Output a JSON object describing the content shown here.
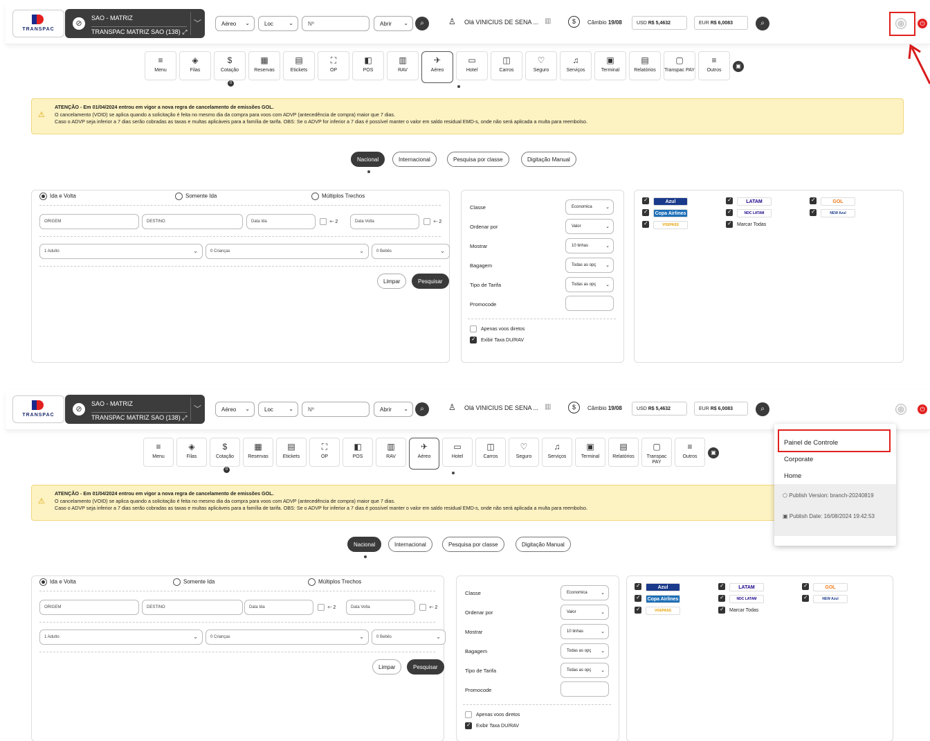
{
  "header": {
    "logo_text": "TRANSPAC",
    "agency_line1": "SAO - MATRIZ",
    "agency_line2": "TRANSPAC MATRIZ SAO (138)",
    "product_select": "Aéreo",
    "loc_select": "Loc",
    "number_placeholder": "Nº",
    "open_select": "Abrir",
    "greeting": "Olá VINICIUS DE SENA ...",
    "exchange_label": "Câmbio",
    "exchange_date": "19/08",
    "usd_label": "USD",
    "usd_value": "R$ 5,4632",
    "eur_label": "EUR",
    "eur_value": "R$ 6,0083"
  },
  "nav": [
    {
      "label": "Menu",
      "icon": "≡"
    },
    {
      "label": "Filas",
      "icon": "◈"
    },
    {
      "label": "Cotação",
      "icon": "$"
    },
    {
      "label": "Reservas",
      "icon": "▦"
    },
    {
      "label": "Etickets",
      "icon": "▤"
    },
    {
      "label": "OP",
      "icon": "⛶"
    },
    {
      "label": "POS",
      "icon": "◧"
    },
    {
      "label": "RAV",
      "icon": "▥"
    },
    {
      "label": "Aéreo",
      "icon": "✈"
    },
    {
      "label": "Hotel",
      "icon": "▭"
    },
    {
      "label": "Carros",
      "icon": "◫"
    },
    {
      "label": "Seguro",
      "icon": "♡"
    },
    {
      "label": "Serviços",
      "icon": "♫"
    },
    {
      "label": "Terminal",
      "icon": "▣"
    },
    {
      "label": "Relatórios",
      "icon": "▤"
    },
    {
      "label": "Transpac PAY",
      "icon": "▢"
    },
    {
      "label": "Outros",
      "icon": "≡"
    }
  ],
  "cotacao_badge": "0",
  "warning": {
    "title": "ATENÇÃO - Em 01/04/2024 entrou em vigor a nova regra de cancelamento de emissões GOL.",
    "line1": "O cancelamento (VOID) se aplica quando a solicitação é feita no mesmo dia da compra para voos com ADVP (antecedência de compra) maior que 7 dias.",
    "line2": "Caso o ADVP seja inferior a 7 dias serão cobradas as taxas e multas aplicáveis para a família de tarifa. OBS: Se o ADVP for inferior a 7 dias é possível manter o valor em saldo residual EMD-s, onde não será aplicada a multa para reembolso."
  },
  "search_tabs": [
    "Nacional",
    "Internacional",
    "Pesquisa por classe",
    "Digitação Manual"
  ],
  "form": {
    "trip_ida_volta": "Ida e Volta",
    "trip_somente_ida": "Somente Ida",
    "trip_multiplos": "Múltiplos Trechos",
    "origin_placeholder": "ORIGEM",
    "destination_placeholder": "DESTINO",
    "date_ida_placeholder": "Data Ida",
    "flex_label": "+- 2",
    "date_volta_placeholder": "Data Volta",
    "adults": "1 Adulto",
    "children": "0 Crianças",
    "babies": "0 Bebês",
    "clear_button": "Limpar",
    "search_button": "Pesquisar"
  },
  "options": {
    "classe_label": "Classe",
    "classe_value": "Economica",
    "ordenar_label": "Ordenar por",
    "ordenar_value": "Valor",
    "mostrar_label": "Mostrar",
    "mostrar_value": "10 linhas",
    "bagagem_label": "Bagagem",
    "bagagem_value": "Todas as opç",
    "tarifa_label": "Tipo de Tarifa",
    "tarifa_value": "Todas as opç",
    "promocode_label": "Promocode",
    "diretos_label": "Apenas voos diretos",
    "taxa_label": "Exibir Taxa DU/RAV"
  },
  "airlines": {
    "azul": "Azul",
    "latam": "LATAM",
    "gol": "GOL",
    "copa": "Copa Airlines",
    "ndc_latam": "NDC LATAM",
    "new_azul": "NEW Azul",
    "voepass": "VOEPASS",
    "marcar_todas": "Marcar Todas"
  },
  "dropdown": {
    "item1": "Painel de Controle",
    "item2": "Corporate",
    "item3": "Home",
    "publish_version": "Publish Version: branch-20240819",
    "publish_date": "Publish Date: 16/08/2024 19:42:53"
  },
  "colors": {
    "accent_dark": "#3a3a3a",
    "warning_bg": "#fdf2c2",
    "highlight_red": "#e0201c"
  }
}
